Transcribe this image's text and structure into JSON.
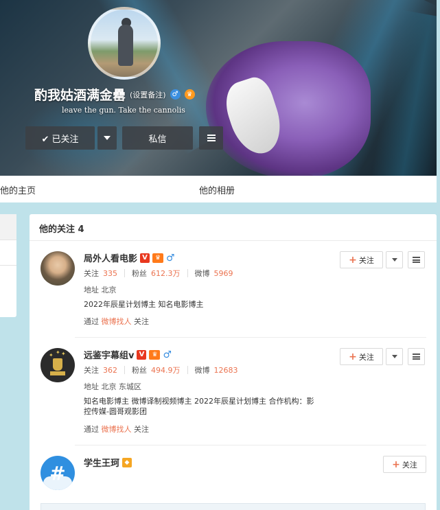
{
  "profile": {
    "name": "酌我姑酒满金罍",
    "remark": "(设置备注)",
    "bio": "leave the gun. Take the cannolis",
    "buttons": {
      "following": "✔ 已关注",
      "message": "私信"
    }
  },
  "nav": {
    "home": "他的主页",
    "album": "他的相册"
  },
  "follow_list": {
    "title": "他的关注 4",
    "items": [
      {
        "name": "局外人看电影",
        "following_label": "关注",
        "following": "335",
        "fans_label": "粉丝",
        "fans": "612.3万",
        "weibo_label": "微博",
        "weibo": "5969",
        "location": "地址 北京",
        "desc": "2022年辰星计划博主 知名电影博主",
        "via_prefix": "通过",
        "via_link": "微博找人",
        "via_suffix": "关注",
        "follow_btn": "关注"
      },
      {
        "name": "远鉴宇幕组v",
        "following_label": "关注",
        "following": "362",
        "fans_label": "粉丝",
        "fans": "494.9万",
        "weibo_label": "微博",
        "weibo": "12683",
        "location": "地址 北京 东城区",
        "desc": "知名电影博主 微博译制视频博主 2022年辰星计划博主 合作机构：影控传媒-圆哥观影团",
        "via_prefix": "通过",
        "via_link": "微博找人",
        "via_suffix": "关注",
        "follow_btn": "关注"
      },
      {
        "name": "学生王珂",
        "follow_btn": "关注"
      }
    ]
  },
  "colors": {
    "accent": "#eb7350",
    "page_bg": "#bfe2ea",
    "verified_red": "#e8381f",
    "male_blue": "#3b8fe0"
  }
}
